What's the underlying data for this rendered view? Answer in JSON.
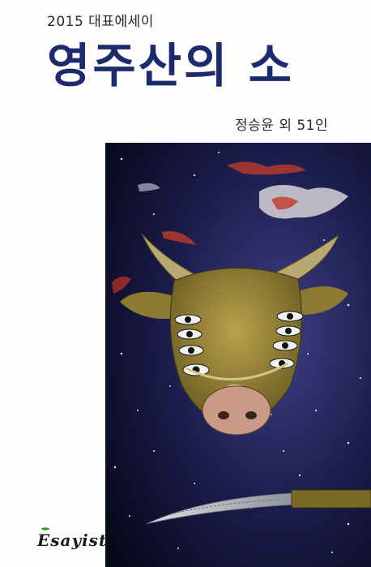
{
  "cover": {
    "series_label": "2015 대표에세이",
    "title": "영주산의 소",
    "author_line": "정승윤 외 51인",
    "publisher_logo": "Esayist"
  },
  "colors": {
    "title": "#1c2a6e",
    "art_background": "#0b0d1e",
    "bull_body": "#9b8a3e",
    "snout": "#c99a85"
  },
  "art": {
    "subject": "bull-with-many-eyes-icon"
  }
}
